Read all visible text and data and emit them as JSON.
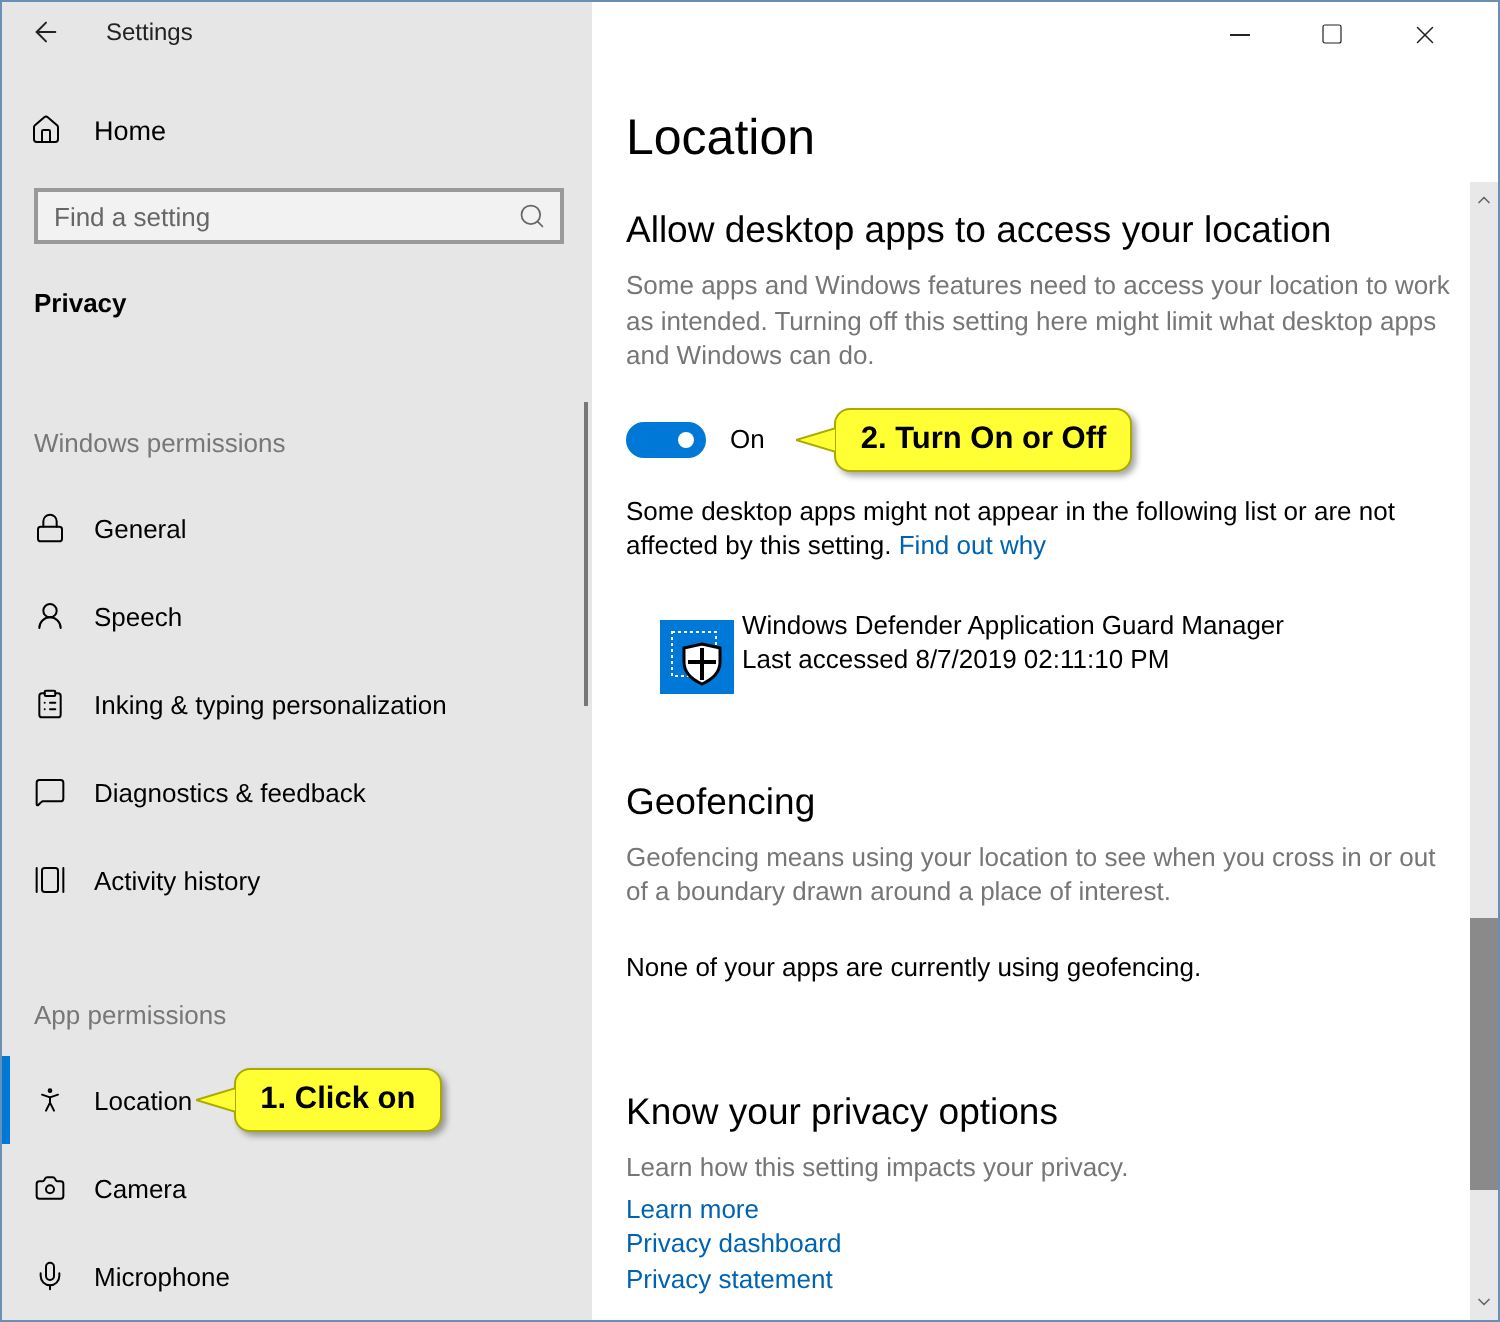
{
  "window": {
    "title": "Settings"
  },
  "sidebar": {
    "home": "Home",
    "search": {
      "placeholder": "Find a setting"
    },
    "section": "Privacy",
    "groups": [
      {
        "heading": "Windows permissions",
        "items": [
          {
            "label": "General",
            "selected": false
          },
          {
            "label": "Speech",
            "selected": false
          },
          {
            "label": "Inking & typing personalization",
            "selected": false
          },
          {
            "label": "Diagnostics & feedback",
            "selected": false
          },
          {
            "label": "Activity history",
            "selected": false
          }
        ]
      },
      {
        "heading": "App permissions",
        "items": [
          {
            "label": "Location",
            "selected": true
          },
          {
            "label": "Camera",
            "selected": false
          },
          {
            "label": "Microphone",
            "selected": false
          }
        ]
      }
    ]
  },
  "page": {
    "title": "Location",
    "access": {
      "heading": "Allow desktop apps to access your location",
      "description": "Some apps and Windows features need to access your location to work as intended. Turning off this setting here might limit what desktop apps and Windows can do.",
      "toggle": {
        "on": true,
        "label": "On"
      },
      "note": "Some desktop apps might not appear in the following list or are not affected by this setting.",
      "note_link": "Find out why",
      "apps": [
        {
          "name": "Windows Defender Application Guard Manager",
          "last_accessed": "Last accessed 8/7/2019 02:11:10 PM"
        }
      ]
    },
    "geofencing": {
      "heading": "Geofencing",
      "description": "Geofencing means using your location to see when you cross in or out of a boundary drawn around a place of interest.",
      "status": "None of your apps are currently using geofencing."
    },
    "privacy": {
      "heading": "Know your privacy options",
      "description": "Learn how this setting impacts your privacy.",
      "links": [
        "Learn more",
        "Privacy dashboard",
        "Privacy statement"
      ]
    }
  },
  "callouts": [
    {
      "text": "1. Click on"
    },
    {
      "text": "2. Turn On or Off"
    }
  ]
}
